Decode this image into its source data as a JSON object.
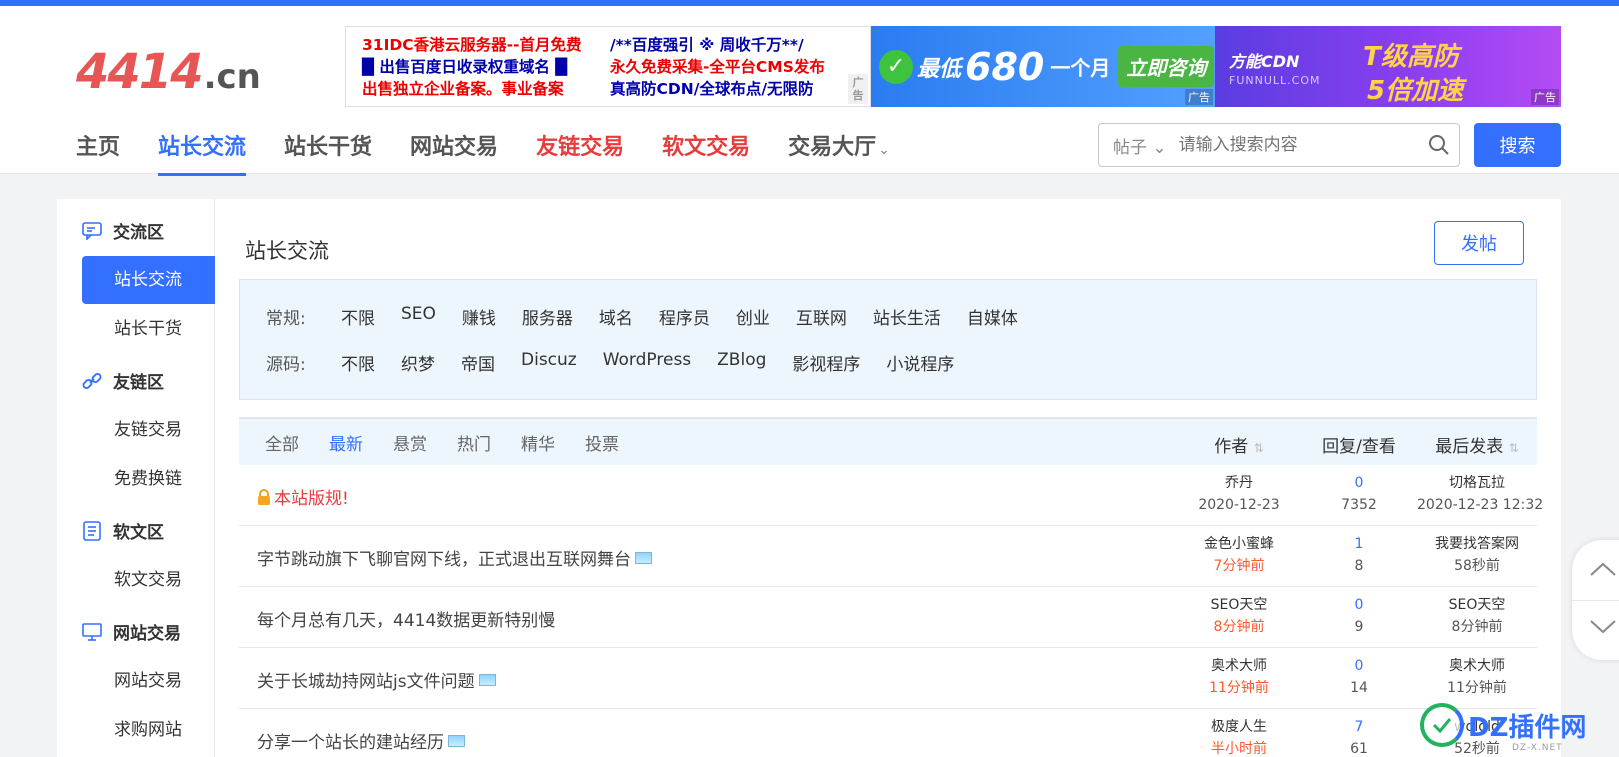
{
  "site": {
    "logo_main": "4414",
    "logo_tld": ".cn"
  },
  "ads": {
    "text_ad": {
      "left": [
        "31IDC香港云服务器--首月免费",
        "█ 出售百度日收录权重域名 █",
        "出售独立企业备案。事业备案"
      ],
      "right": [
        "/**百度强引 ※ 周收千万**/",
        "永久免费采集-全平台CMS发布",
        "真高防CDN/全球布点/无限防"
      ],
      "tag": "广告"
    },
    "banner1": {
      "lead": "最低",
      "price": "680",
      "unit": "一个月",
      "cta": "立即咨询",
      "tag": "广告"
    },
    "banner2": {
      "brand": "方能CDN",
      "brand_sub": "FUNNULL.COM",
      "line1": "T级高防",
      "line2": "5倍加速",
      "tag": "广告"
    }
  },
  "nav": {
    "items": [
      {
        "label": "主页",
        "style": "normal"
      },
      {
        "label": "站长交流",
        "style": "active"
      },
      {
        "label": "站长干货",
        "style": "normal"
      },
      {
        "label": "网站交易",
        "style": "normal"
      },
      {
        "label": "友链交易",
        "style": "red"
      },
      {
        "label": "软文交易",
        "style": "red"
      },
      {
        "label": "交易大厅",
        "style": "normal"
      }
    ]
  },
  "search": {
    "type": "帖子",
    "placeholder": "请输入搜索内容",
    "button": "搜索"
  },
  "sidebar": {
    "groups": [
      {
        "label": "交流区",
        "icon": "chat-icon",
        "items": [
          "站长交流",
          "站长干货"
        ]
      },
      {
        "label": "友链区",
        "icon": "link-icon",
        "items": [
          "友链交易",
          "免费换链"
        ]
      },
      {
        "label": "软文区",
        "icon": "document-icon",
        "items": [
          "软文交易"
        ]
      },
      {
        "label": "网站交易",
        "icon": "monitor-icon",
        "items": [
          "网站交易",
          "求购网站"
        ]
      }
    ],
    "active_item": "站长交流"
  },
  "content": {
    "title": "站长交流",
    "post_button": "发帖",
    "filters": {
      "row1_label": "常规:",
      "row1": [
        "不限",
        "SEO",
        "赚钱",
        "服务器",
        "域名",
        "程序员",
        "创业",
        "互联网",
        "站长生活",
        "自媒体"
      ],
      "row2_label": "源码:",
      "row2": [
        "不限",
        "织梦",
        "帝国",
        "Discuz",
        "WordPress",
        "ZBlog",
        "影视程序",
        "小说程序"
      ]
    },
    "list": {
      "tabs": [
        "全部",
        "最新",
        "悬赏",
        "热门",
        "精华",
        "投票"
      ],
      "active_tab": "最新",
      "headers": {
        "author": "作者",
        "reply": "回复/查看",
        "last": "最后发表"
      },
      "rows": [
        {
          "title": "本站版规!",
          "locked": true,
          "has_image": false,
          "author": "乔丹",
          "author_time": "2020-12-23",
          "time_hot": false,
          "replies": "0",
          "views": "7352",
          "last_user": "切格瓦拉",
          "last_time": "2020-12-23 12:32"
        },
        {
          "title": "字节跳动旗下飞聊官网下线，正式退出互联网舞台",
          "locked": false,
          "has_image": true,
          "author": "金色小蜜蜂",
          "author_time": "7分钟前",
          "time_hot": true,
          "replies": "1",
          "views": "8",
          "last_user": "我要找答案网",
          "last_time": "58秒前"
        },
        {
          "title": "每个月总有几天，4414数据更新特别慢",
          "locked": false,
          "has_image": false,
          "author": "SEO天空",
          "author_time": "8分钟前",
          "time_hot": true,
          "replies": "0",
          "views": "9",
          "last_user": "SEO天空",
          "last_time": "8分钟前"
        },
        {
          "title": "关于长城劫持网站js文件问题",
          "locked": false,
          "has_image": true,
          "author": "奥术大师",
          "author_time": "11分钟前",
          "time_hot": true,
          "replies": "0",
          "views": "14",
          "last_user": "奥术大师",
          "last_time": "11分钟前"
        },
        {
          "title": "分享一个站长的建站经历",
          "locked": false,
          "has_image": true,
          "author": "极度人生",
          "author_time": "半小时前",
          "time_hot": true,
          "replies": "7",
          "views": "61",
          "last_user": "wdldld",
          "last_time": "52秒前"
        }
      ]
    }
  },
  "watermark": {
    "text": "DZ插件网",
    "sub": "DZ-X.NET"
  },
  "colors": {
    "accent": "#3370ff",
    "red": "#e83c3c",
    "hot": "#ff5a2a",
    "filter_bg": "#eef6fd"
  }
}
